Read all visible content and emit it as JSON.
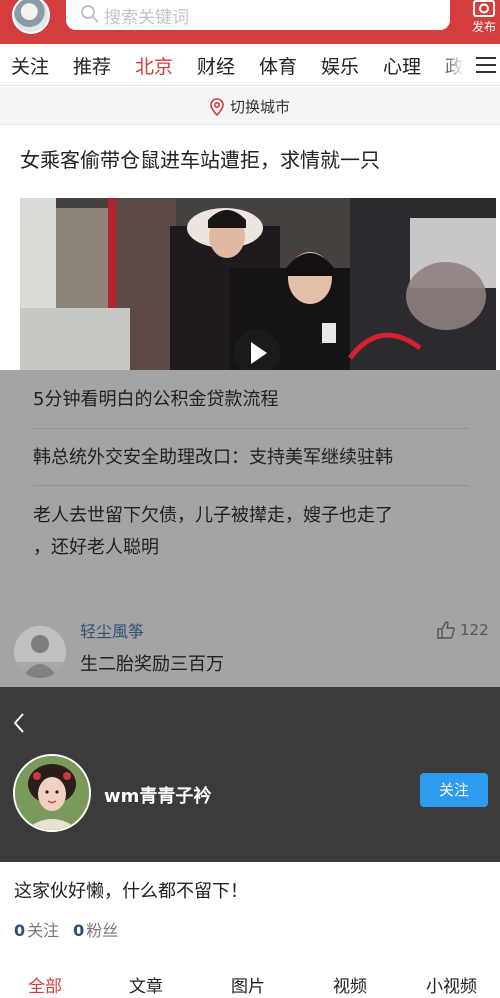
{
  "header": {
    "search_placeholder": "搜索关键词",
    "publish_label": "发布"
  },
  "channels": [
    "关注",
    "推荐",
    "北京",
    "财经",
    "体育",
    "娱乐",
    "心理",
    "政"
  ],
  "active_channel": "北京",
  "city_switch": {
    "label": "切换城市"
  },
  "feed": {
    "headline": "女乘客偷带仓鼠进车站遭拒，求情就一只",
    "related": [
      "5分钟看明白的公积金贷款流程",
      "韩总统外交安全助理改口：支持美军继续驻韩",
      "老人去世留下欠债，儿子被撵走，嫂子也走了",
      "，还好老人聪明"
    ],
    "comment": {
      "user": "轻尘風筝",
      "text": "生二胎奖励三百万",
      "likes": "122"
    }
  },
  "profile": {
    "name": "wm青青子衿",
    "follow_label": "关注",
    "bio": "这家伙好懒，什么都不留下！",
    "following_count": "0",
    "following_label": "关注",
    "followers_count": "0",
    "followers_label": "粉丝",
    "tabs": [
      "全部",
      "文章",
      "图片",
      "视频",
      "小视频"
    ],
    "active_tab": "全部"
  },
  "colors": {
    "brand_red": "#d43d3d",
    "follow_blue": "#2d9bf0",
    "dim_overlay": "#a4a4a4",
    "profile_bg": "#3b3b3b"
  }
}
